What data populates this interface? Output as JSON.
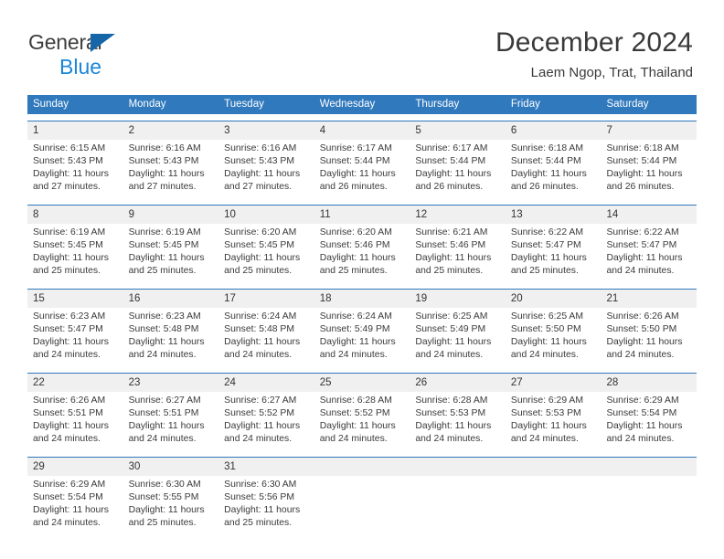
{
  "brand": {
    "name_part1": "General",
    "name_part2": "Blue",
    "triangle_color": "#1565a8",
    "blue_color": "#1b86d8"
  },
  "header": {
    "title": "December 2024",
    "subtitle": "Laem Ngop, Trat, Thailand"
  },
  "theme": {
    "header_row_color": "#3079bd",
    "daynum_band_color": "#f0f0f0",
    "week_divider_color": "#2f78bc",
    "text_color": "#3a3a3a"
  },
  "calendar": {
    "weekday_headers": [
      "Sunday",
      "Monday",
      "Tuesday",
      "Wednesday",
      "Thursday",
      "Friday",
      "Saturday"
    ],
    "weeks": [
      {
        "days": [
          {
            "num": "1",
            "sunrise": "Sunrise: 6:15 AM",
            "sunset": "Sunset: 5:43 PM",
            "daylight_l1": "Daylight: 11 hours",
            "daylight_l2": "and 27 minutes."
          },
          {
            "num": "2",
            "sunrise": "Sunrise: 6:16 AM",
            "sunset": "Sunset: 5:43 PM",
            "daylight_l1": "Daylight: 11 hours",
            "daylight_l2": "and 27 minutes."
          },
          {
            "num": "3",
            "sunrise": "Sunrise: 6:16 AM",
            "sunset": "Sunset: 5:43 PM",
            "daylight_l1": "Daylight: 11 hours",
            "daylight_l2": "and 27 minutes."
          },
          {
            "num": "4",
            "sunrise": "Sunrise: 6:17 AM",
            "sunset": "Sunset: 5:44 PM",
            "daylight_l1": "Daylight: 11 hours",
            "daylight_l2": "and 26 minutes."
          },
          {
            "num": "5",
            "sunrise": "Sunrise: 6:17 AM",
            "sunset": "Sunset: 5:44 PM",
            "daylight_l1": "Daylight: 11 hours",
            "daylight_l2": "and 26 minutes."
          },
          {
            "num": "6",
            "sunrise": "Sunrise: 6:18 AM",
            "sunset": "Sunset: 5:44 PM",
            "daylight_l1": "Daylight: 11 hours",
            "daylight_l2": "and 26 minutes."
          },
          {
            "num": "7",
            "sunrise": "Sunrise: 6:18 AM",
            "sunset": "Sunset: 5:44 PM",
            "daylight_l1": "Daylight: 11 hours",
            "daylight_l2": "and 26 minutes."
          }
        ]
      },
      {
        "days": [
          {
            "num": "8",
            "sunrise": "Sunrise: 6:19 AM",
            "sunset": "Sunset: 5:45 PM",
            "daylight_l1": "Daylight: 11 hours",
            "daylight_l2": "and 25 minutes."
          },
          {
            "num": "9",
            "sunrise": "Sunrise: 6:19 AM",
            "sunset": "Sunset: 5:45 PM",
            "daylight_l1": "Daylight: 11 hours",
            "daylight_l2": "and 25 minutes."
          },
          {
            "num": "10",
            "sunrise": "Sunrise: 6:20 AM",
            "sunset": "Sunset: 5:45 PM",
            "daylight_l1": "Daylight: 11 hours",
            "daylight_l2": "and 25 minutes."
          },
          {
            "num": "11",
            "sunrise": "Sunrise: 6:20 AM",
            "sunset": "Sunset: 5:46 PM",
            "daylight_l1": "Daylight: 11 hours",
            "daylight_l2": "and 25 minutes."
          },
          {
            "num": "12",
            "sunrise": "Sunrise: 6:21 AM",
            "sunset": "Sunset: 5:46 PM",
            "daylight_l1": "Daylight: 11 hours",
            "daylight_l2": "and 25 minutes."
          },
          {
            "num": "13",
            "sunrise": "Sunrise: 6:22 AM",
            "sunset": "Sunset: 5:47 PM",
            "daylight_l1": "Daylight: 11 hours",
            "daylight_l2": "and 25 minutes."
          },
          {
            "num": "14",
            "sunrise": "Sunrise: 6:22 AM",
            "sunset": "Sunset: 5:47 PM",
            "daylight_l1": "Daylight: 11 hours",
            "daylight_l2": "and 24 minutes."
          }
        ]
      },
      {
        "days": [
          {
            "num": "15",
            "sunrise": "Sunrise: 6:23 AM",
            "sunset": "Sunset: 5:47 PM",
            "daylight_l1": "Daylight: 11 hours",
            "daylight_l2": "and 24 minutes."
          },
          {
            "num": "16",
            "sunrise": "Sunrise: 6:23 AM",
            "sunset": "Sunset: 5:48 PM",
            "daylight_l1": "Daylight: 11 hours",
            "daylight_l2": "and 24 minutes."
          },
          {
            "num": "17",
            "sunrise": "Sunrise: 6:24 AM",
            "sunset": "Sunset: 5:48 PM",
            "daylight_l1": "Daylight: 11 hours",
            "daylight_l2": "and 24 minutes."
          },
          {
            "num": "18",
            "sunrise": "Sunrise: 6:24 AM",
            "sunset": "Sunset: 5:49 PM",
            "daylight_l1": "Daylight: 11 hours",
            "daylight_l2": "and 24 minutes."
          },
          {
            "num": "19",
            "sunrise": "Sunrise: 6:25 AM",
            "sunset": "Sunset: 5:49 PM",
            "daylight_l1": "Daylight: 11 hours",
            "daylight_l2": "and 24 minutes."
          },
          {
            "num": "20",
            "sunrise": "Sunrise: 6:25 AM",
            "sunset": "Sunset: 5:50 PM",
            "daylight_l1": "Daylight: 11 hours",
            "daylight_l2": "and 24 minutes."
          },
          {
            "num": "21",
            "sunrise": "Sunrise: 6:26 AM",
            "sunset": "Sunset: 5:50 PM",
            "daylight_l1": "Daylight: 11 hours",
            "daylight_l2": "and 24 minutes."
          }
        ]
      },
      {
        "days": [
          {
            "num": "22",
            "sunrise": "Sunrise: 6:26 AM",
            "sunset": "Sunset: 5:51 PM",
            "daylight_l1": "Daylight: 11 hours",
            "daylight_l2": "and 24 minutes."
          },
          {
            "num": "23",
            "sunrise": "Sunrise: 6:27 AM",
            "sunset": "Sunset: 5:51 PM",
            "daylight_l1": "Daylight: 11 hours",
            "daylight_l2": "and 24 minutes."
          },
          {
            "num": "24",
            "sunrise": "Sunrise: 6:27 AM",
            "sunset": "Sunset: 5:52 PM",
            "daylight_l1": "Daylight: 11 hours",
            "daylight_l2": "and 24 minutes."
          },
          {
            "num": "25",
            "sunrise": "Sunrise: 6:28 AM",
            "sunset": "Sunset: 5:52 PM",
            "daylight_l1": "Daylight: 11 hours",
            "daylight_l2": "and 24 minutes."
          },
          {
            "num": "26",
            "sunrise": "Sunrise: 6:28 AM",
            "sunset": "Sunset: 5:53 PM",
            "daylight_l1": "Daylight: 11 hours",
            "daylight_l2": "and 24 minutes."
          },
          {
            "num": "27",
            "sunrise": "Sunrise: 6:29 AM",
            "sunset": "Sunset: 5:53 PM",
            "daylight_l1": "Daylight: 11 hours",
            "daylight_l2": "and 24 minutes."
          },
          {
            "num": "28",
            "sunrise": "Sunrise: 6:29 AM",
            "sunset": "Sunset: 5:54 PM",
            "daylight_l1": "Daylight: 11 hours",
            "daylight_l2": "and 24 minutes."
          }
        ]
      },
      {
        "days": [
          {
            "num": "29",
            "sunrise": "Sunrise: 6:29 AM",
            "sunset": "Sunset: 5:54 PM",
            "daylight_l1": "Daylight: 11 hours",
            "daylight_l2": "and 24 minutes."
          },
          {
            "num": "30",
            "sunrise": "Sunrise: 6:30 AM",
            "sunset": "Sunset: 5:55 PM",
            "daylight_l1": "Daylight: 11 hours",
            "daylight_l2": "and 25 minutes."
          },
          {
            "num": "31",
            "sunrise": "Sunrise: 6:30 AM",
            "sunset": "Sunset: 5:56 PM",
            "daylight_l1": "Daylight: 11 hours",
            "daylight_l2": "and 25 minutes."
          },
          {
            "num": "",
            "sunrise": "",
            "sunset": "",
            "daylight_l1": "",
            "daylight_l2": ""
          },
          {
            "num": "",
            "sunrise": "",
            "sunset": "",
            "daylight_l1": "",
            "daylight_l2": ""
          },
          {
            "num": "",
            "sunrise": "",
            "sunset": "",
            "daylight_l1": "",
            "daylight_l2": ""
          },
          {
            "num": "",
            "sunrise": "",
            "sunset": "",
            "daylight_l1": "",
            "daylight_l2": ""
          }
        ]
      }
    ]
  }
}
